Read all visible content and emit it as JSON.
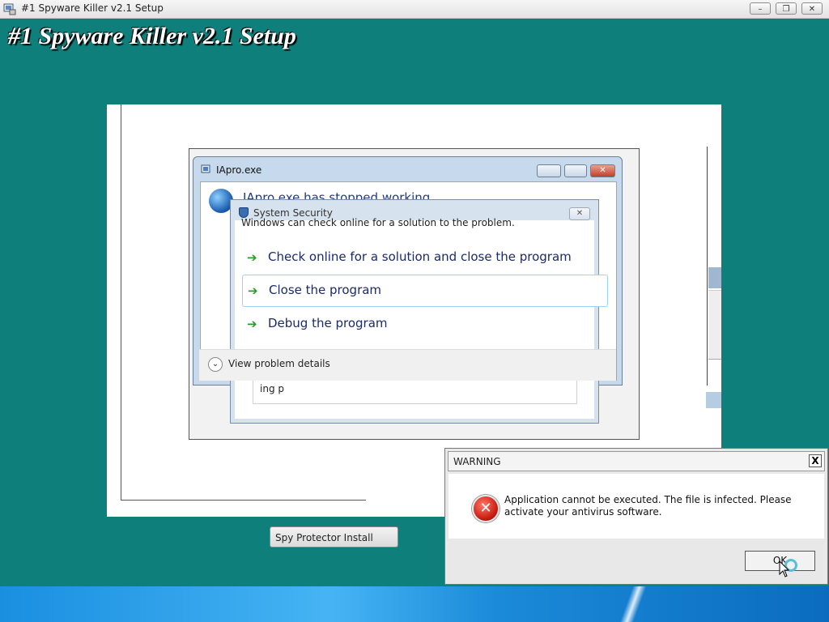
{
  "window": {
    "title": "#1 Spyware Killer v2.1 Setup",
    "banner": "#1 Spyware Killer v2.1 Setup",
    "controls": {
      "minimize": "–",
      "maximize": "❐",
      "close": "✕"
    }
  },
  "iapro_dialog": {
    "title": "IApro.exe",
    "heading": "IApro.exe has stopped working",
    "subtext": "Windows can check online for a solution to the problem.",
    "options": [
      {
        "label": "Check online for a solution and close the program"
      },
      {
        "label": "Close the program"
      },
      {
        "label": "Debug the program"
      }
    ],
    "details_label": "View problem details",
    "close_glyph": "✕"
  },
  "security_dialog": {
    "title": "System Security",
    "close_glyph": "✕",
    "partial_text": "ing         p"
  },
  "spy_button": {
    "label": "Spy Protector Install"
  },
  "warning_dialog": {
    "title": "WARNING",
    "close_glyph": "X",
    "message": "Application cannot be executed. The file is infected. Please activate your antivirus software.",
    "ok_label": "OK"
  },
  "colors": {
    "desktop": "#0e7f7b",
    "banner_text": "#ffffff",
    "arrow_green": "#2a9a2a",
    "error_red": "#c81b10"
  }
}
